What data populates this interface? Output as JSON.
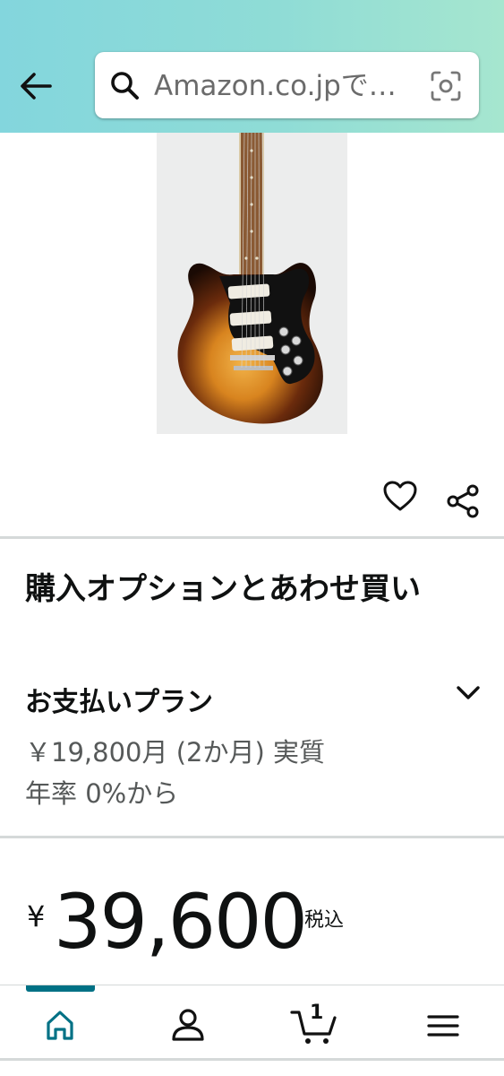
{
  "header": {
    "search_placeholder": "Amazon.co.jpで…",
    "back_icon": "arrow-left-icon",
    "search_icon": "search-icon",
    "camera_icon": "camera-scan-icon",
    "gradient_colors": [
      "#83d6dd",
      "#a6e6cf"
    ]
  },
  "product": {
    "image_alt_icon": "electric-guitar-image"
  },
  "actions": {
    "favorite_icon": "heart-icon",
    "share_icon": "share-icon"
  },
  "purchase_options": {
    "title": "購入オプションとあわせ買い",
    "payment_plan": {
      "title": "お支払いプラン",
      "line1": "￥19,800月 (2か月) 実質",
      "line2": "年率 0%から"
    }
  },
  "price": {
    "currency": "¥",
    "amount": "39,600",
    "tax_label": "税込"
  },
  "bottom_nav": {
    "items": [
      "home-icon",
      "account-icon",
      "cart-icon",
      "menu-icon"
    ],
    "cart_count": "1",
    "accent_color": "#007185"
  }
}
